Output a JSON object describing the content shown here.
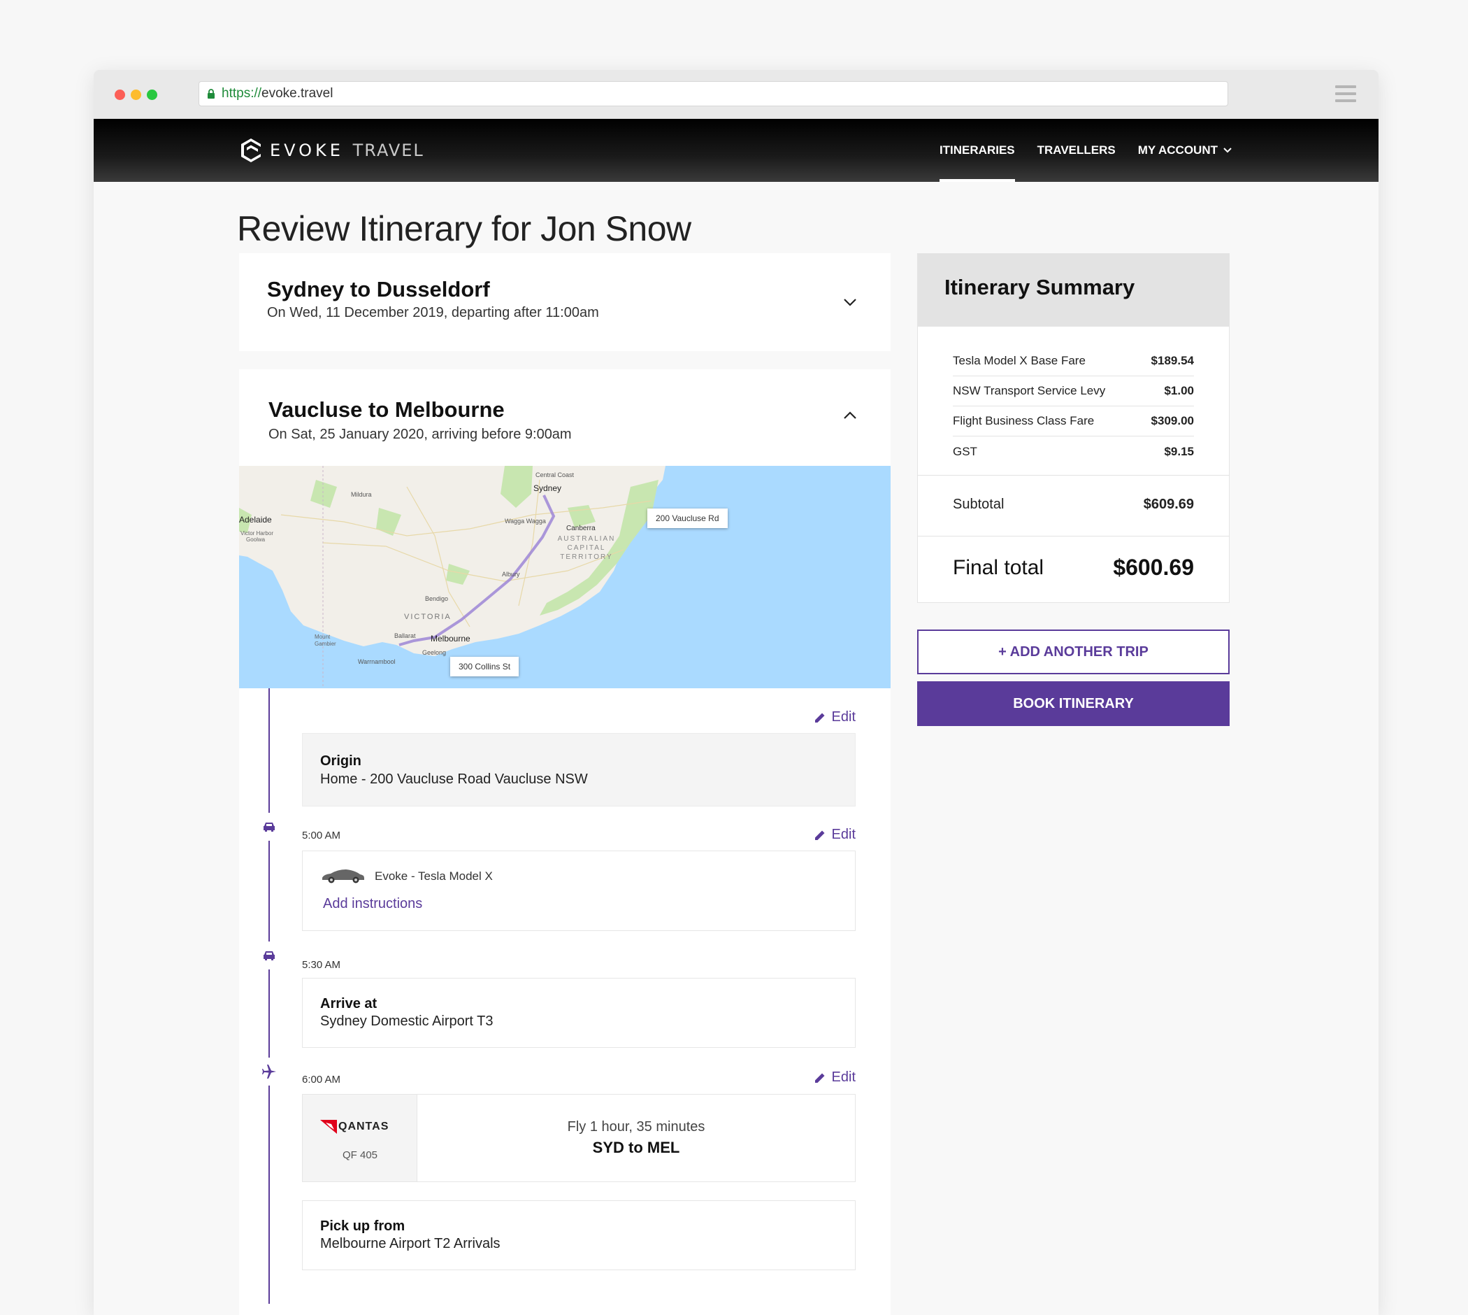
{
  "browser": {
    "url_scheme": "https://",
    "url_host": "evoke.travel"
  },
  "brand": {
    "name_primary": "EVOKE",
    "name_secondary": "TRAVEL",
    "accent_color": "#5a3b9a"
  },
  "nav": {
    "items": [
      {
        "label": "ITINERARIES",
        "active": true
      },
      {
        "label": "TRAVELLERS",
        "active": false
      },
      {
        "label": "MY ACCOUNT",
        "active": false
      }
    ]
  },
  "page": {
    "title": "Review Itinerary for Jon Snow"
  },
  "trips": [
    {
      "title": "Sydney to Dusseldorf",
      "subtitle": "On Wed, 11 December 2019, departing after 11:00am",
      "expanded": false
    },
    {
      "title": "Vaucluse to Melbourne",
      "subtitle": "On Sat, 25 January 2020, arriving before 9:00am",
      "expanded": true,
      "map": {
        "labels": {
          "start_pin": "200 Vaucluse Rd",
          "end_pin": "300 Collins St",
          "central_coast": "Central Coast",
          "sydney": "Sydney",
          "adelaide": "Adelaide",
          "victor_harbor": "Victor Harbor",
          "goolwa": "Goolwa",
          "mildura": "Mildura",
          "wagga": "Wagga Wagga",
          "canberra": "Canberra",
          "act": "AUSTRALIAN CAPITAL TERRITORY",
          "albury": "Albury",
          "bendigo": "Bendigo",
          "victoria": "VICTORIA",
          "ballarat": "Ballarat",
          "melbourne": "Melbourne",
          "mount_gambier": "Mount Gambier",
          "geelong": "Geelong",
          "warrnambool": "Warrnambool"
        }
      },
      "edit_label": "Edit",
      "origin": {
        "label": "Origin",
        "value": "Home - 200 Vaucluse Road Vaucluse NSW"
      },
      "car": {
        "time": "5:00 AM",
        "name": "Evoke - Tesla Model X",
        "add_instructions": "Add instructions",
        "icon": "car-icon"
      },
      "arrive": {
        "time": "5:30 AM",
        "label": "Arrive at",
        "value": "Sydney Domestic Airport T3",
        "icon": "car-icon"
      },
      "flight": {
        "time": "6:00 AM",
        "airline": "QANTAS",
        "number": "QF 405",
        "duration": "Fly 1 hour,  35 minutes",
        "route": "SYD to MEL",
        "icon": "plane-icon"
      },
      "pickup": {
        "label": "Pick up from",
        "value": "Melbourne Airport T2 Arrivals"
      }
    }
  ],
  "summary": {
    "title": "Itinerary Summary",
    "line_items": [
      {
        "label": "Tesla Model X Base Fare",
        "amount": "$189.54"
      },
      {
        "label": "NSW Transport Service Levy",
        "amount": "$1.00"
      },
      {
        "label": "Flight Business Class Fare",
        "amount": "$309.00"
      },
      {
        "label": "GST",
        "amount": "$9.15"
      }
    ],
    "subtotal_label": "Subtotal",
    "subtotal_amount": "$609.69",
    "final_label": "Final total",
    "final_amount": "$600.69"
  },
  "actions": {
    "add_trip": "+ ADD ANOTHER TRIP",
    "book": "BOOK ITINERARY"
  }
}
